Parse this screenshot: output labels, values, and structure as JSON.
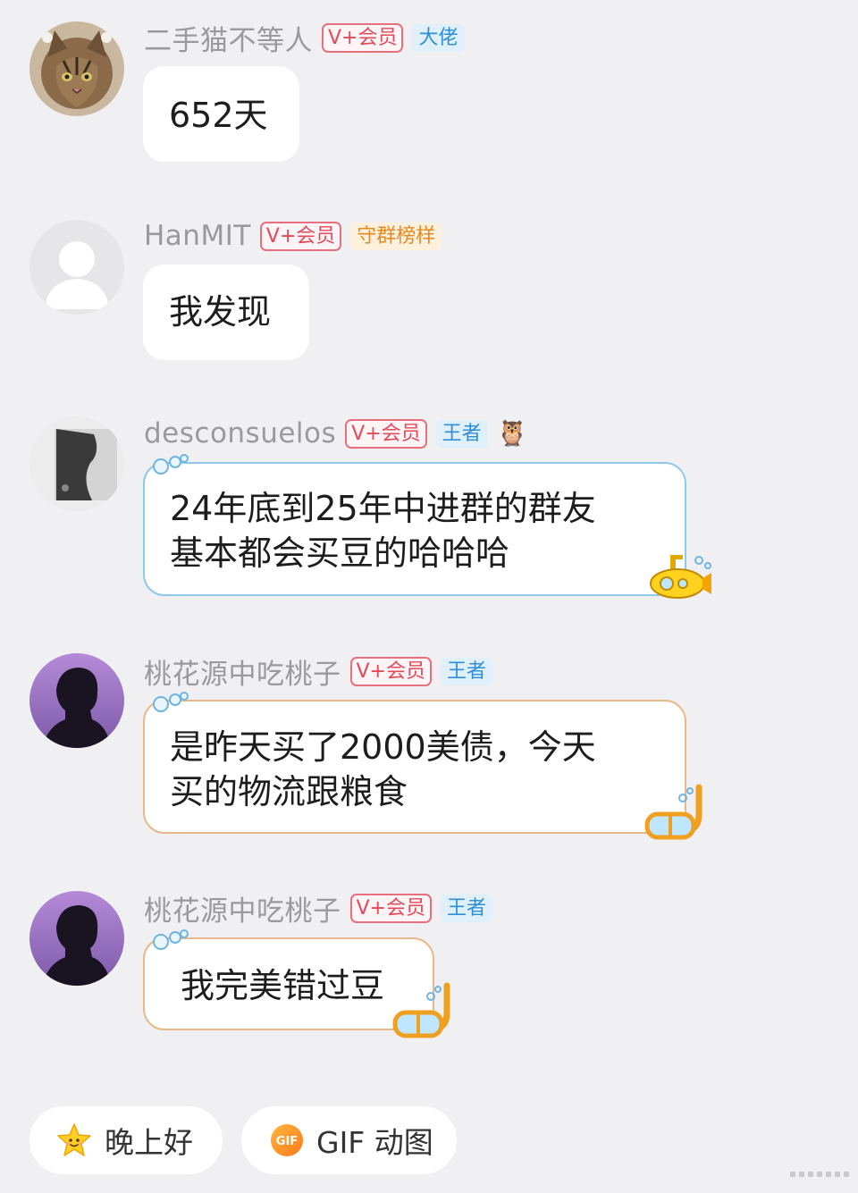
{
  "messages": [
    {
      "username": "二手猫不等人",
      "badges": {
        "vip": "V+会员",
        "rank": "大佬"
      },
      "text": "652天",
      "avatar": "cat-photo"
    },
    {
      "username": "HanMIT",
      "badges": {
        "vip": "V+会员",
        "rank": "守群榜样"
      },
      "text": "我发现",
      "avatar": "default-user"
    },
    {
      "username": "desconsuelos",
      "badges": {
        "vip": "V+会员",
        "rank": "王者",
        "extra_icon": "🦉"
      },
      "text": "24年底到25年中进群的群友\n基本都会买豆的哈哈哈",
      "avatar": "gray-abstract"
    },
    {
      "username": "桃花源中吃桃子",
      "badges": {
        "vip": "V+会员",
        "rank": "王者"
      },
      "text": "是昨天买了2000美债，今天\n买的物流跟粮食",
      "avatar": "silhouette-purple"
    },
    {
      "username": "桃花源中吃桃子",
      "badges": {
        "vip": "V+会员",
        "rank": "王者"
      },
      "text": "我完美错过豆",
      "avatar": "silhouette-purple"
    }
  ],
  "quick_replies": [
    {
      "label": "晚上好",
      "icon": "smiling-star-icon"
    },
    {
      "label": "GIF 动图",
      "icon": "gif-icon",
      "icon_text": "GIF"
    }
  ],
  "colors": {
    "background": "#f0f0f2",
    "vip_badge": "#e04a5a",
    "rank_blue": "#2e8fd6",
    "rank_orange": "#e8891e"
  }
}
